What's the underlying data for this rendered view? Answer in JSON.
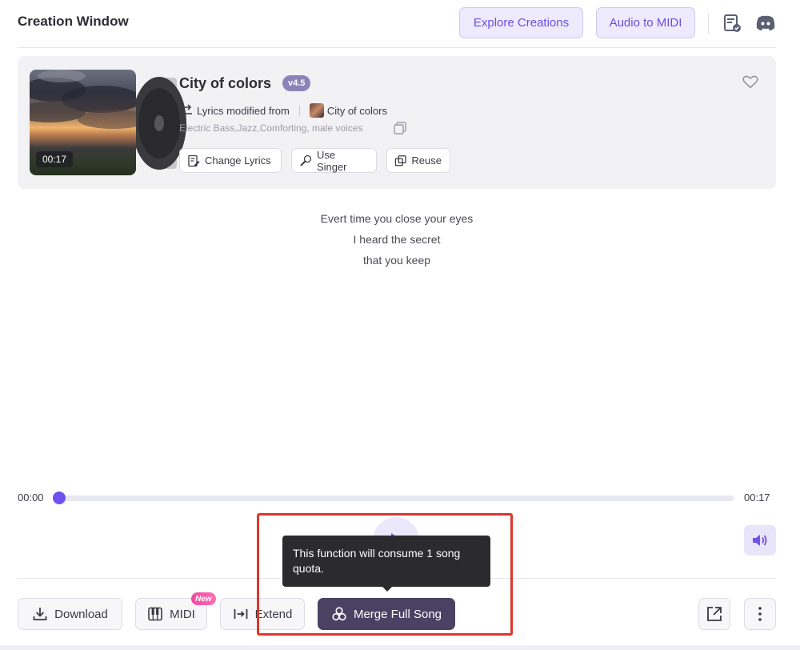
{
  "header": {
    "title": "Creation Window",
    "explore_label": "Explore Creations",
    "audio_midi_label": "Audio to MIDI"
  },
  "song": {
    "duration_badge": "00:17",
    "title": "City of colors",
    "version": "v4.5",
    "modified_label": "Lyrics modified from",
    "source_title": "City of colors",
    "tags": "Electric Bass,Jazz,Comforting, male voices",
    "actions": {
      "change_lyrics": "Change Lyrics",
      "use_singer": "Use Singer",
      "reuse": "Reuse"
    }
  },
  "lyrics": [
    "Evert time you close your eyes",
    "I heard the secret",
    "that you keep"
  ],
  "player": {
    "current_time": "00:00",
    "total_time": "00:17",
    "progress": 0
  },
  "tooltip": {
    "text": "This function will consume 1 song quota."
  },
  "toolbar": {
    "download": "Download",
    "midi": "MIDI",
    "new_badge": "New",
    "extend": "Extend",
    "merge": "Merge Full Song"
  },
  "colors": {
    "accent": "#6f52ee",
    "merge_bg": "#4b4163",
    "highlight": "#e0352b"
  }
}
